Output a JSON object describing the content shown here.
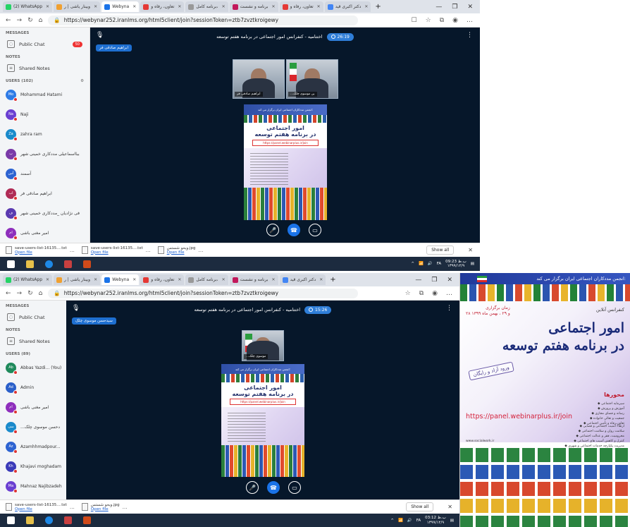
{
  "shot1": {
    "tabs": [
      "(2) WhatsApp",
      "وبینار یاشی | ر",
      "Webyna",
      "تعاون، رفاه و",
      "برنامه کامل،",
      "برنامه و نشست",
      "تعاون، رفاه و",
      "دکتر اکبری قید"
    ],
    "url": "https://webynar252.iranlms.org/html5client/join?sessionToken=ztb7zvztkroigewy",
    "sidebar": {
      "messages_title": "MESSAGES",
      "public_chat": "Public Chat",
      "chat_badge": "50",
      "notes_title": "NOTES",
      "shared_notes": "Shared Notes",
      "users_title": "USERS (102)",
      "users": [
        {
          "initials": "Mo",
          "name": "Mohammad Hatami",
          "color": "#2e7be6"
        },
        {
          "initials": "Na",
          "name": "Naji",
          "color": "#6a3fd1"
        },
        {
          "initials": "Za",
          "name": "zahra ram",
          "color": "#1a8acb"
        },
        {
          "initials": "ب",
          "name": "ببا‌اسماعیلی مددکاری خمینی شهر",
          "color": "#7a3aa8"
        },
        {
          "initials": "آس",
          "name": "آسمند",
          "color": "#2d63d1"
        },
        {
          "initials": "اب",
          "name": "ابراهیم صادقی فر",
          "color": "#b02b55"
        },
        {
          "initials": "ف",
          "name": "فی نژادیان _مددکاری خمینی شهر",
          "color": "#5b3ab0"
        },
        {
          "initials": "ام",
          "name": "امیر مغنی باشی",
          "color": "#8e2ebc"
        }
      ]
    },
    "meeting_title": "اختتامیه - کنفرانس امور اجتماعی در برنامه هفتم توسعه",
    "timer": "26:19",
    "presenter": "ابراهیم صادقی فر",
    "videos": [
      "ابراهیم صادقی فر",
      "...ین موسوی چلک"
    ],
    "downloads": [
      {
        "name": "save-users-list-16135....txt",
        "action": "Open file"
      },
      {
        "name": "save-users-list-16135....txt",
        "action": "Open file"
      },
      {
        "name": "وبحو شستس.jpg",
        "action": "Open file"
      }
    ],
    "show_all": "Show all",
    "clock": {
      "time": "09:23 ب.ظ",
      "date": "۱۳۹۹/۱۲/۹"
    },
    "lang": "FA"
  },
  "shot2": {
    "url": "https://webynar252.iranlms.org/html5client/join?sessionToken=ztb7zvztkroigewy",
    "sidebar": {
      "messages_title": "MESSAGES",
      "public_chat": "Public Chat",
      "chat_badge": "40",
      "notes_title": "NOTES",
      "shared_notes": "Shared Notes",
      "users_title": "USERS (89)",
      "users": [
        {
          "initials": "Ab",
          "name": "Abbas Yazdi... (You)",
          "color": "#1f8a5b"
        },
        {
          "initials": "Ad",
          "name": "Admin",
          "color": "#2a5fc9"
        },
        {
          "initials": "ام",
          "name": "امیر مغنی باشی",
          "color": "#8e2ebc"
        },
        {
          "initials": "سی",
          "name": "...دحسن موسوی چلک",
          "color": "#1a8acb"
        },
        {
          "initials": "Az",
          "name": "Azamhhmadpour...",
          "color": "#2d63d1"
        },
        {
          "initials": "Kh",
          "name": "Khajavi moghadam",
          "color": "#3a3ab8"
        },
        {
          "initials": "Ma",
          "name": "Mahnaz Najibzadeh",
          "color": "#6a3fd1"
        },
        {
          "initials": "Ma",
          "name": "Masoomeh dastge...",
          "color": "#5b3ab0"
        }
      ]
    },
    "meeting_title": "اختتامیه - کنفرانس امور اجتماعی در برنامه هفتم توسعه",
    "timer": "15:26",
    "presenter": "سیدحسن موسوی چلک",
    "video": "...موسوی چلک",
    "downloads": [
      {
        "name": "save-users-list-16135....txt",
        "action": "Open file"
      },
      {
        "name": "وبحو شستس.jpg",
        "action": "Open file"
      }
    ],
    "show_all": "Show all",
    "clock": {
      "time": "03:12 ب.ظ",
      "date": "۱۳۹۹/۱۲/۹"
    },
    "lang": "FA"
  },
  "slide": {
    "header": "انجمن مددکاران اجتماعی ایران برگزار می کند:",
    "title_line1": "امور اجتماعی",
    "title_line2": "در برنامه هفتم توسعه",
    "link": "https://panel.webinarplus.ir/join"
  },
  "poster": {
    "header": "انجمن مددکاران اجتماعی ایران برگزار می کند:",
    "conf_label": "کنفرانس آنلاین",
    "date_label": "زمان برگزاری",
    "date_value": "۲۸ و ۲۹ ، بهمن ماه ۱۳۹۹",
    "title_line1": "امور اجتماعی",
    "title_line2": "در برنامه هفتم توسعه",
    "stamp": "ورود آزاد و رایگان",
    "axes_heading": "محورها",
    "axes": [
      "سیرمایه اجتماعی",
      "آموزش و پرورش",
      "رسانه و فضای مجازی",
      "جمعیت و تعالی خانواده",
      "تعاون،رفاه و تأمین اجتماعی"
    ],
    "axes2": [
      "ارتقاء امنیت اجتماعی و قضایی",
      "سلامت روان و سلامت اجتماعی",
      "محرومیت، فقر و عدالت اجتماعی",
      "کنترل و کاهش آسیب های اجتماعی",
      "مدیریت یکپارچه خدمات اجتماعی و شهری",
      "مدیریت بحران، مشکلات روانی، اجتماعی در بلایا"
    ],
    "url": "https://panel.webinarplus.ir/join",
    "site": "www.socialwork.ir"
  }
}
